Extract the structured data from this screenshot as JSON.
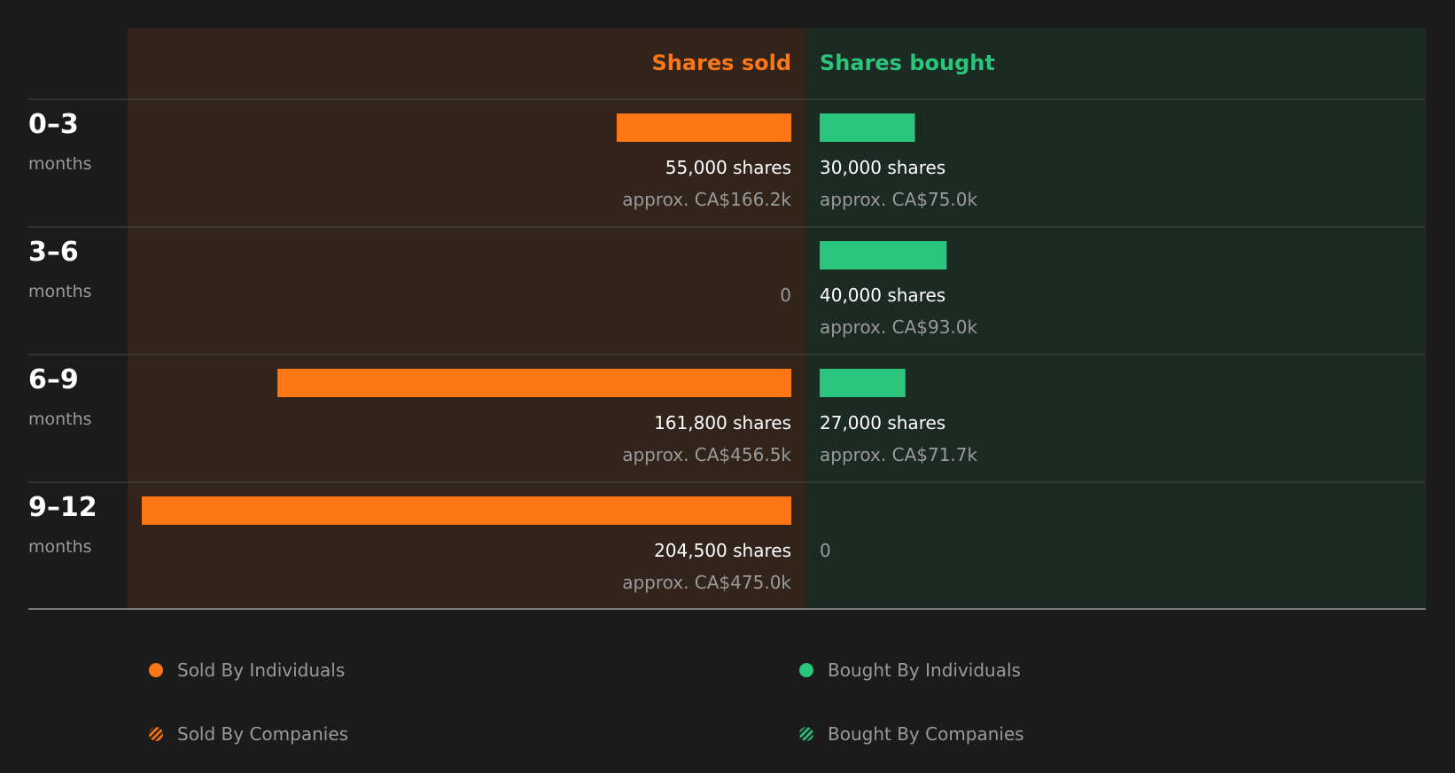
{
  "colors": {
    "page_bg": "#1b1b1b",
    "sold_panel": "#32231b",
    "bought_panel": "#1c2a24",
    "sold": "#fd7717",
    "bought": "#2bc47b",
    "row_divider": "#4a4a4a",
    "axis_line": "#9a9a9a",
    "primary_text": "#ffffff",
    "secondary_text": "#9a9a9a"
  },
  "chart_data": {
    "type": "bar",
    "orientation": "horizontal-diverging",
    "headers": {
      "sold": "Shares sold",
      "bought": "Shares bought"
    },
    "period_unit": "months",
    "categories": [
      "0–3",
      "3–6",
      "6–9",
      "9–12"
    ],
    "series": [
      {
        "key": "sold",
        "values": [
          55000,
          0,
          161800,
          204500
        ],
        "labels": [
          "55,000 shares",
          "0",
          "161,800 shares",
          "204,500 shares"
        ],
        "approx": [
          "approx. CA$166.2k",
          "",
          "approx. CA$456.5k",
          "approx. CA$475.0k"
        ]
      },
      {
        "key": "bought",
        "values": [
          30000,
          40000,
          27000,
          0
        ],
        "labels": [
          "30,000 shares",
          "40,000 shares",
          "27,000 shares",
          "0"
        ],
        "approx": [
          "approx. CA$75.0k",
          "approx. CA$93.0k",
          "approx. CA$71.7k",
          ""
        ]
      }
    ],
    "max_value": 204500
  },
  "legend": [
    {
      "label": "Sold By Individuals",
      "marker": "solid-dot",
      "color": "#fd7717"
    },
    {
      "label": "Bought By Individuals",
      "marker": "solid-dot",
      "color": "#2bc47b"
    },
    {
      "label": "Sold By Companies",
      "marker": "striped-dot",
      "color": "#fd7717"
    },
    {
      "label": "Bought By Companies",
      "marker": "striped-dot",
      "color": "#2bc47b"
    }
  ]
}
